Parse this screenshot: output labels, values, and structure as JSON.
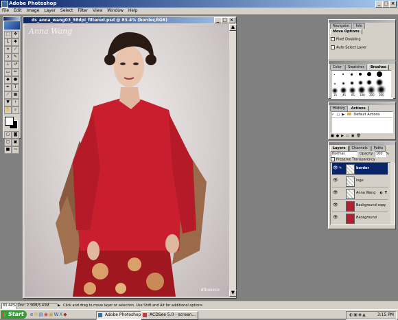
{
  "app": {
    "title": "Adobe Photoshop"
  },
  "menu": [
    "File",
    "Edit",
    "Image",
    "Layer",
    "Select",
    "Filter",
    "View",
    "Window",
    "Help"
  ],
  "document": {
    "title": "ds_anna_wang03_98dpi_filtered.psd @ 83.4% (border,RGB)",
    "watermark": "Anna Wang",
    "signature": "dSoweca"
  },
  "navigator_panel": {
    "tabs": [
      "Navigator",
      "Info",
      "Move Options"
    ],
    "checkboxes": [
      "Pixel Doubling",
      "Auto Select Layer"
    ]
  },
  "brushes_panel": {
    "tabs": [
      "Color",
      "Swatches",
      "Brushes"
    ],
    "size_labels": [
      "35",
      "45",
      "65",
      "100",
      "200",
      "300"
    ]
  },
  "actions_panel": {
    "tabs": [
      "History",
      "Actions"
    ],
    "items": [
      "Default Actions"
    ]
  },
  "layers_panel": {
    "tabs": [
      "Layers",
      "Channels",
      "Paths"
    ],
    "blend_mode": "Normal",
    "opacity_label": "Opacity:",
    "opacity_value": "100",
    "opacity_unit": "%",
    "preserve_label": "Preserve Transparency",
    "layers": [
      "border",
      "logo",
      "Anna Wang",
      "Background copy",
      "Background"
    ]
  },
  "status": {
    "zoom": "83.44%",
    "doc": "Doc: 2.36M/5.43M",
    "hint": "Click and drag to move layer or selection. Use Shift and Alt for additional options."
  },
  "taskbar": {
    "start": "Start",
    "buttons": [
      "Adobe Photoshop",
      "ACDSee 5.0 - screen..."
    ],
    "time": "3:15 PM"
  },
  "colors": {
    "title_active": "#0a246a",
    "chrome": "#d4d0c8",
    "workspace": "#808080",
    "sweater": "#c81e2e",
    "taskbar_start": "#3a9a3a"
  }
}
